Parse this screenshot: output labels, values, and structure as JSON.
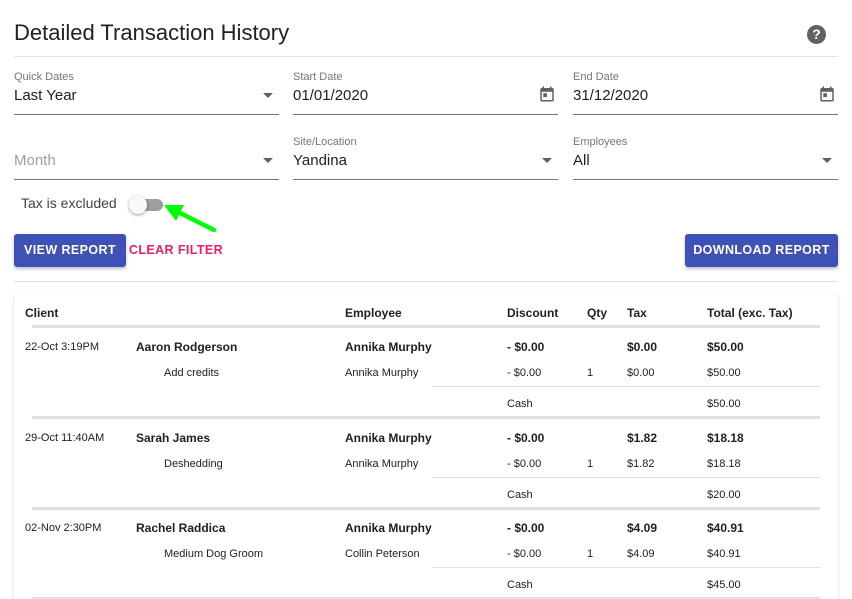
{
  "header": {
    "title": "Detailed Transaction History",
    "help_icon": "help-icon"
  },
  "filters": {
    "quick_dates": {
      "label": "Quick Dates",
      "value": "Last Year"
    },
    "start_date": {
      "label": "Start Date",
      "value": "01/01/2020"
    },
    "end_date": {
      "label": "End Date",
      "value": "31/12/2020"
    },
    "month": {
      "placeholder": "Month"
    },
    "site": {
      "label": "Site/Location",
      "value": "Yandina"
    },
    "employees": {
      "label": "Employees",
      "value": "All"
    },
    "tax_toggle": {
      "label": "Tax is excluded"
    }
  },
  "actions": {
    "view_report": "VIEW REPORT",
    "clear_filter": "CLEAR FILTER",
    "download_report": "DOWNLOAD REPORT"
  },
  "colors": {
    "primary": "#3f51b5",
    "accent": "#e91e63",
    "arrow": "#00ff00"
  },
  "table": {
    "headers": {
      "client": "Client",
      "employee": "Employee",
      "discount": "Discount",
      "qty": "Qty",
      "tax": "Tax",
      "total": "Total (exc. Tax)"
    },
    "transactions": [
      {
        "datetime": "22-Oct 3:19PM",
        "client": "Aaron Rodgerson",
        "employee": "Annika Murphy",
        "discount": "- $0.00",
        "tax": "$0.00",
        "total": "$50.00",
        "item": {
          "name": "Add credits",
          "employee": "Annika Murphy",
          "discount": "- $0.00",
          "qty": "1",
          "tax": "$0.00",
          "total": "$50.00"
        },
        "payment": {
          "method": "Cash",
          "amount": "$50.00"
        }
      },
      {
        "datetime": "29-Oct 11:40AM",
        "client": "Sarah James",
        "employee": "Annika Murphy",
        "discount": "- $0.00",
        "tax": "$1.82",
        "total": "$18.18",
        "item": {
          "name": "Deshedding",
          "employee": "Annika Murphy",
          "discount": "- $0.00",
          "qty": "1",
          "tax": "$1.82",
          "total": "$18.18"
        },
        "payment": {
          "method": "Cash",
          "amount": "$20.00"
        }
      },
      {
        "datetime": "02-Nov 2:30PM",
        "client": "Rachel Raddica",
        "employee": "Annika Murphy",
        "discount": "- $0.00",
        "tax": "$4.09",
        "total": "$40.91",
        "item": {
          "name": "Medium Dog Groom",
          "employee": "Collin Peterson",
          "discount": "- $0.00",
          "qty": "1",
          "tax": "$4.09",
          "total": "$40.91"
        },
        "payment": {
          "method": "Cash",
          "amount": "$45.00"
        }
      }
    ]
  }
}
